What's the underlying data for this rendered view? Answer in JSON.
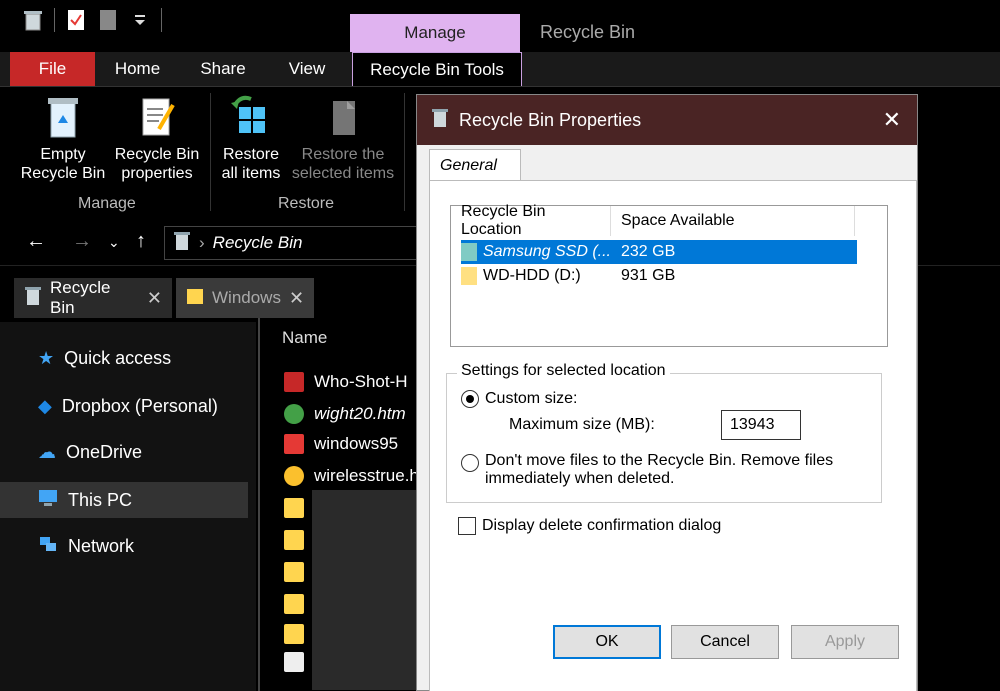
{
  "title_bar": {
    "context_tab": "Manage",
    "window_title": "Recycle Bin"
  },
  "ribbon_tabs": {
    "file": "File",
    "home": "Home",
    "share": "Share",
    "view": "View",
    "tools": "Recycle Bin Tools"
  },
  "ribbon": {
    "empty_line1": "Empty",
    "empty_line2": "Recycle Bin",
    "props_line1": "Recycle Bin",
    "props_line2": "properties",
    "restore_all_line1": "Restore",
    "restore_all_line2": "all items",
    "restore_sel_line1": "Restore the",
    "restore_sel_line2": "selected items",
    "group_manage": "Manage",
    "group_restore": "Restore"
  },
  "address": {
    "path": "Recycle Bin"
  },
  "folder_tabs": [
    {
      "label": "Recycle Bin",
      "close": "✕"
    },
    {
      "label": "Windows",
      "close": "✕"
    }
  ],
  "nav": {
    "items": [
      "Quick access",
      "Dropbox (Personal)",
      "OneDrive",
      "This PC",
      "Network"
    ]
  },
  "file_list": {
    "header": "Name",
    "rows": [
      "Who-Shot-H",
      "wight20.htm",
      "windows95",
      "wirelesstrue.h"
    ]
  },
  "dialog": {
    "title": "Recycle Bin Properties",
    "close": "✕",
    "tab": "General",
    "columns": {
      "location": "Recycle Bin Location",
      "space": "Space Available"
    },
    "drives": [
      {
        "name": "Samsung SSD (...",
        "space": "232 GB",
        "selected": true
      },
      {
        "name": "WD-HDD (D:)",
        "space": "931 GB",
        "selected": false
      }
    ],
    "settings_label": "Settings for selected location",
    "custom_size": "Custom size:",
    "max_size_label": "Maximum size (MB):",
    "max_size_value": "13943",
    "dont_move_line1": "Don't move files to the Recycle Bin. Remove files",
    "dont_move_line2": "immediately when deleted.",
    "confirm_label": "Display delete confirmation dialog",
    "ok": "OK",
    "cancel": "Cancel",
    "apply": "Apply"
  },
  "colors": {
    "file_tab": "#c62828",
    "manage_context": "#e0b3f0",
    "dialog_titlebar": "#4a2424",
    "selection": "#0078d7"
  }
}
